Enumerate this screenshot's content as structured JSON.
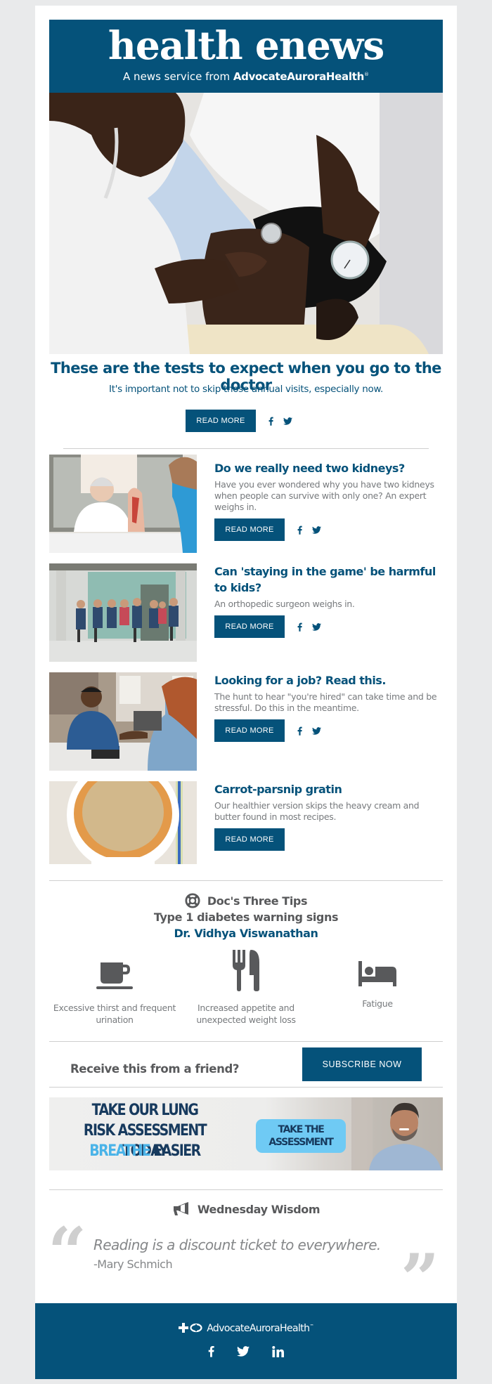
{
  "colors": {
    "brand": "#05527a",
    "page_background": "#e9eaeb",
    "body_text": "#777a7d",
    "heading_gray": "#58595b",
    "banner_cta": "#6fcaf4",
    "banner_text": "#173a5e"
  },
  "masthead": {
    "title": "health enews",
    "subtitle_prefix": "A news service from ",
    "subtitle_brand": "AdvocateAuroraHealth",
    "subtitle_mark": "®"
  },
  "hero": {
    "image_alt": "Doctor measuring a patient's blood pressure",
    "title": "These are the tests to expect when you go to the doctor",
    "description": "It's important not to skip those annual visits, especially now.",
    "button_label": "READ MORE",
    "share": [
      "facebook-icon",
      "twitter-icon"
    ]
  },
  "articles": [
    {
      "image_alt": "Doctor explaining an anatomical model to a child",
      "title": "Do we really need two kidneys?",
      "description": "Have you ever wondered why you have two kidneys when people can survive with only one? An expert weighs in.",
      "button_label": "READ MORE",
      "share": [
        "facebook-icon",
        "twitter-icon"
      ]
    },
    {
      "image_alt": "Group of children running down a school hallway",
      "title": "Can 'staying in the game' be harmful to kids?",
      "description": "An orthopedic surgeon weighs in.",
      "button_label": "READ MORE",
      "share": [
        "facebook-icon",
        "twitter-icon"
      ]
    },
    {
      "image_alt": "Job candidate shaking hands with interviewer",
      "title": "Looking for a job? Read this.",
      "description": "The hunt to hear \"you're hired\" can take time and be stressful. Do this in the meantime.",
      "button_label": "READ MORE",
      "share": [
        "facebook-icon",
        "twitter-icon"
      ]
    },
    {
      "image_alt": "Carrot-parsnip gratin in a white baking dish",
      "title": "Carrot-parsnip gratin",
      "description": "Our healthier version skips the heavy cream and butter found in most recipes.",
      "button_label": "READ MORE",
      "share": []
    }
  ],
  "tips": {
    "section_icon": "lifebuoy-icon",
    "section_title": "Doc's Three Tips",
    "topic": "Type 1 diabetes warning signs",
    "author": "Dr. Vidhya Viswanathan",
    "items": [
      {
        "icon": "coffee-cup-icon",
        "label": "Excessive thirst and frequent urination"
      },
      {
        "icon": "fork-knife-icon",
        "label": "Increased appetite and unexpected weight loss"
      },
      {
        "icon": "bed-icon",
        "label": "Fatigue"
      }
    ]
  },
  "subscribe": {
    "prompt": "Receive this from a friend?",
    "button_label": "SUBSCRIBE NOW"
  },
  "banner": {
    "line1": "TAKE OUR LUNG",
    "line2": "RISK ASSESSMENT TODAY",
    "line3_highlight": "BREATHE",
    "line3_rest": " EASIER",
    "cta_line1": "TAKE THE",
    "cta_line2": "ASSESSMENT",
    "image_alt": "Smiling man in a blue shirt"
  },
  "wisdom": {
    "section_icon": "megaphone-icon",
    "section_title": "Wednesday Wisdom",
    "quote": "Reading is a discount ticket to everywhere.",
    "author": "-Mary Schmich",
    "open_mark": "“",
    "close_mark": "”"
  },
  "footer": {
    "logo_text": "AdvocateAuroraHealth",
    "logo_mark": "™",
    "social": [
      "facebook-icon",
      "twitter-icon",
      "linkedin-icon"
    ]
  }
}
